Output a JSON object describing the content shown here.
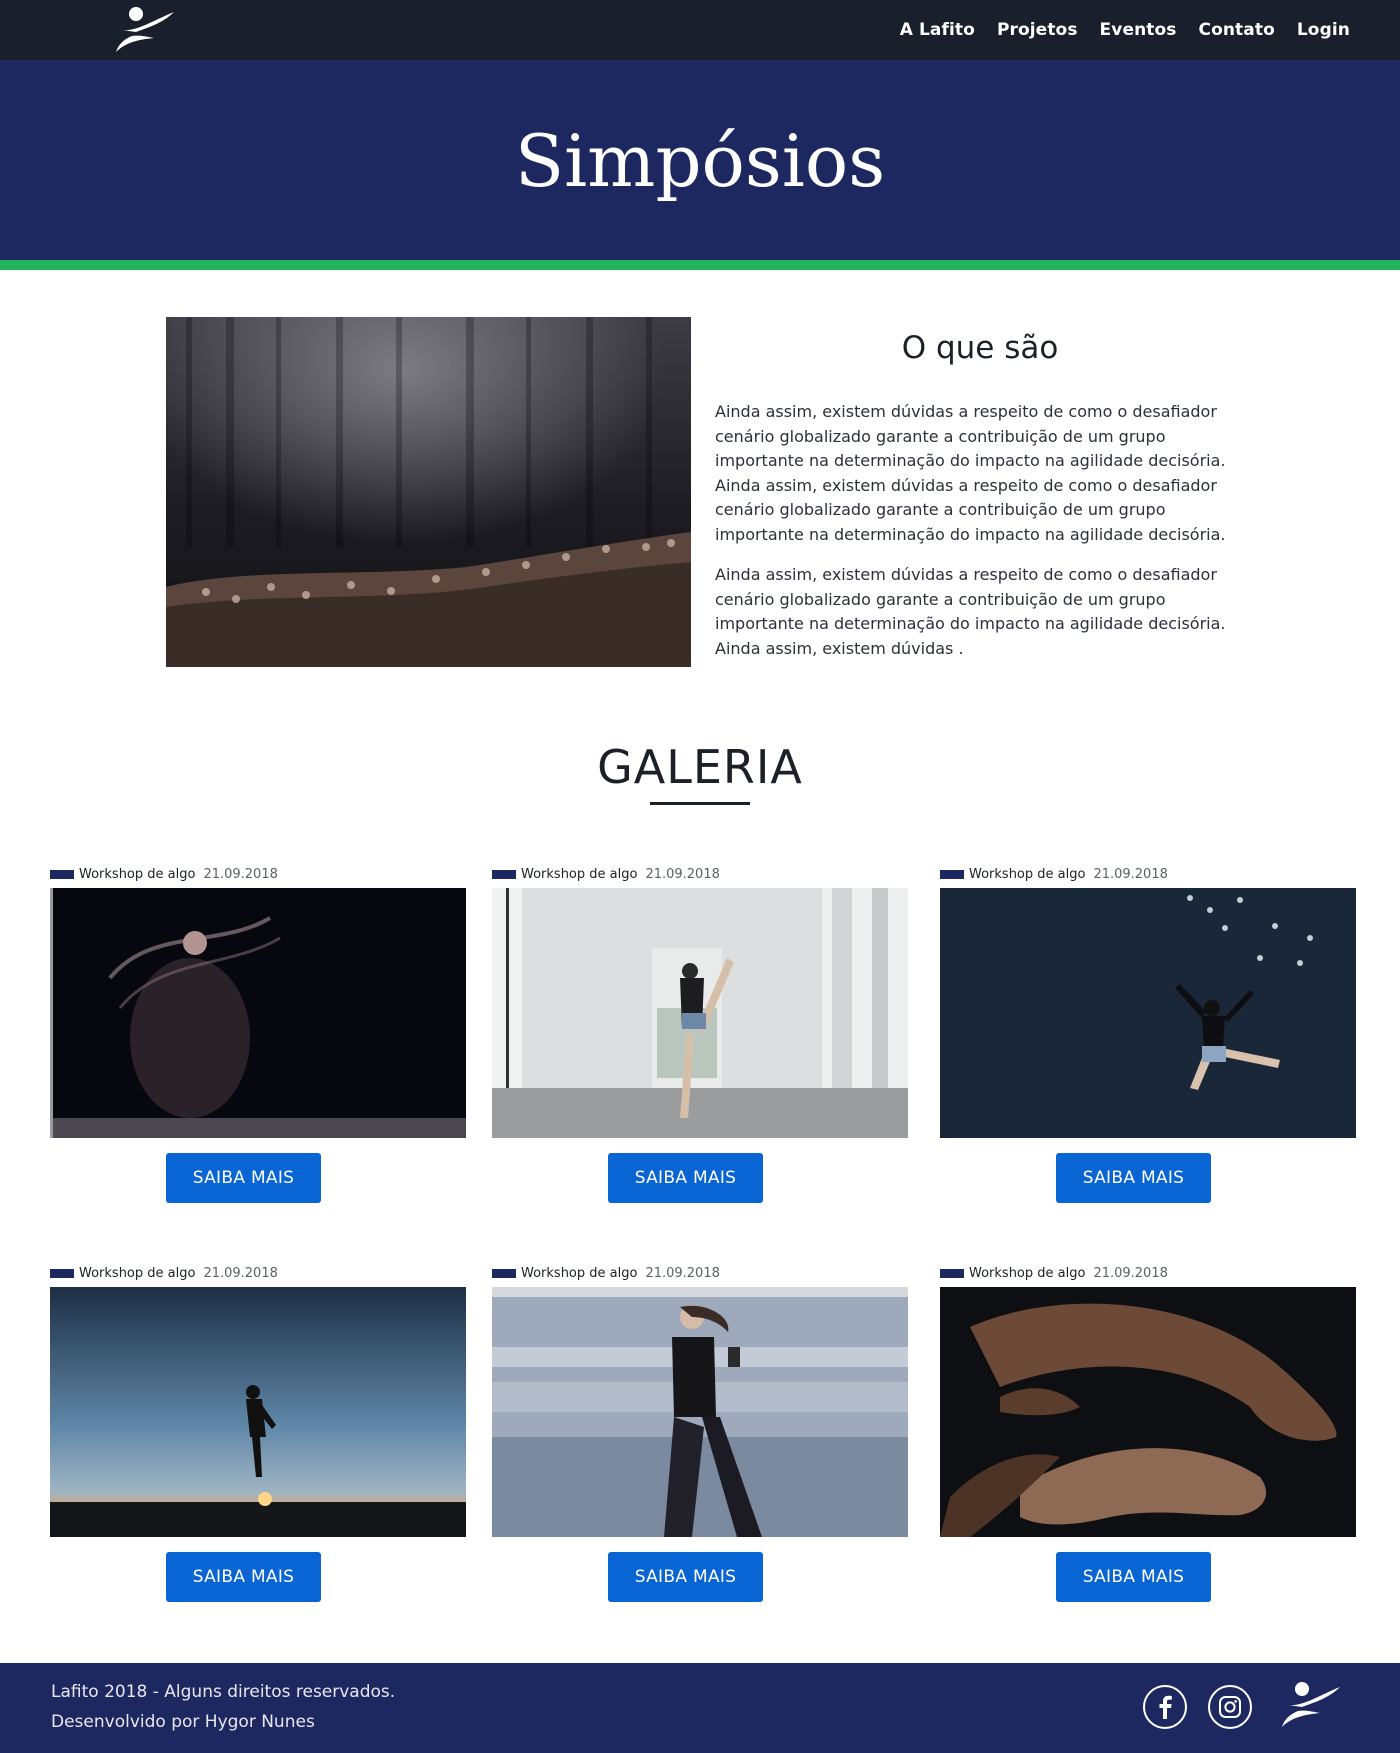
{
  "nav": {
    "logo_icon": "dancer-logo-icon",
    "links": [
      "A Lafito",
      "Projetos",
      "Eventos",
      "Contato",
      "Login"
    ]
  },
  "hero": {
    "title": "Simpósios"
  },
  "about": {
    "title": "O que são",
    "paragraph1": "Ainda assim, existem dúvidas a respeito de como o desafiador cenário globalizado garante a contribuição de um grupo importante na determinação do impacto na agilidade decisória. Ainda assim, existem dúvidas a respeito de como o desafiador cenário globalizado garante a contribuição de um grupo importante na determinação do impacto na agilidade decisória.",
    "paragraph2": "Ainda assim, existem dúvidas a respeito de como o desafiador cenário globalizado garante a contribuição de um grupo importante na determinação do impacto na agilidade decisória. Ainda assim, existem dúvidas ."
  },
  "gallery": {
    "title": "GALERIA",
    "cards": [
      {
        "tag": "Workshop de algo",
        "date": "21.09.2018",
        "button": "SAIBA MAIS"
      },
      {
        "tag": "Workshop de algo",
        "date": "21.09.2018",
        "button": "SAIBA MAIS"
      },
      {
        "tag": "Workshop de algo",
        "date": "21.09.2018",
        "button": "SAIBA MAIS"
      },
      {
        "tag": "Workshop de algo",
        "date": "21.09.2018",
        "button": "SAIBA MAIS"
      },
      {
        "tag": "Workshop de algo",
        "date": "21.09.2018",
        "button": "SAIBA MAIS"
      },
      {
        "tag": "Workshop de algo",
        "date": "21.09.2018",
        "button": "SAIBA MAIS"
      }
    ]
  },
  "footer": {
    "line1": "Lafito 2018 - Alguns direitos reservados.",
    "line2": "Desenvolvido por Hygor Nunes",
    "social_icons": [
      "facebook-icon",
      "instagram-icon"
    ]
  },
  "colors": {
    "topbar": "#19202b",
    "brand_navy": "#1d2860",
    "accent_green": "#25b35a",
    "button_blue": "#0a65d4"
  }
}
